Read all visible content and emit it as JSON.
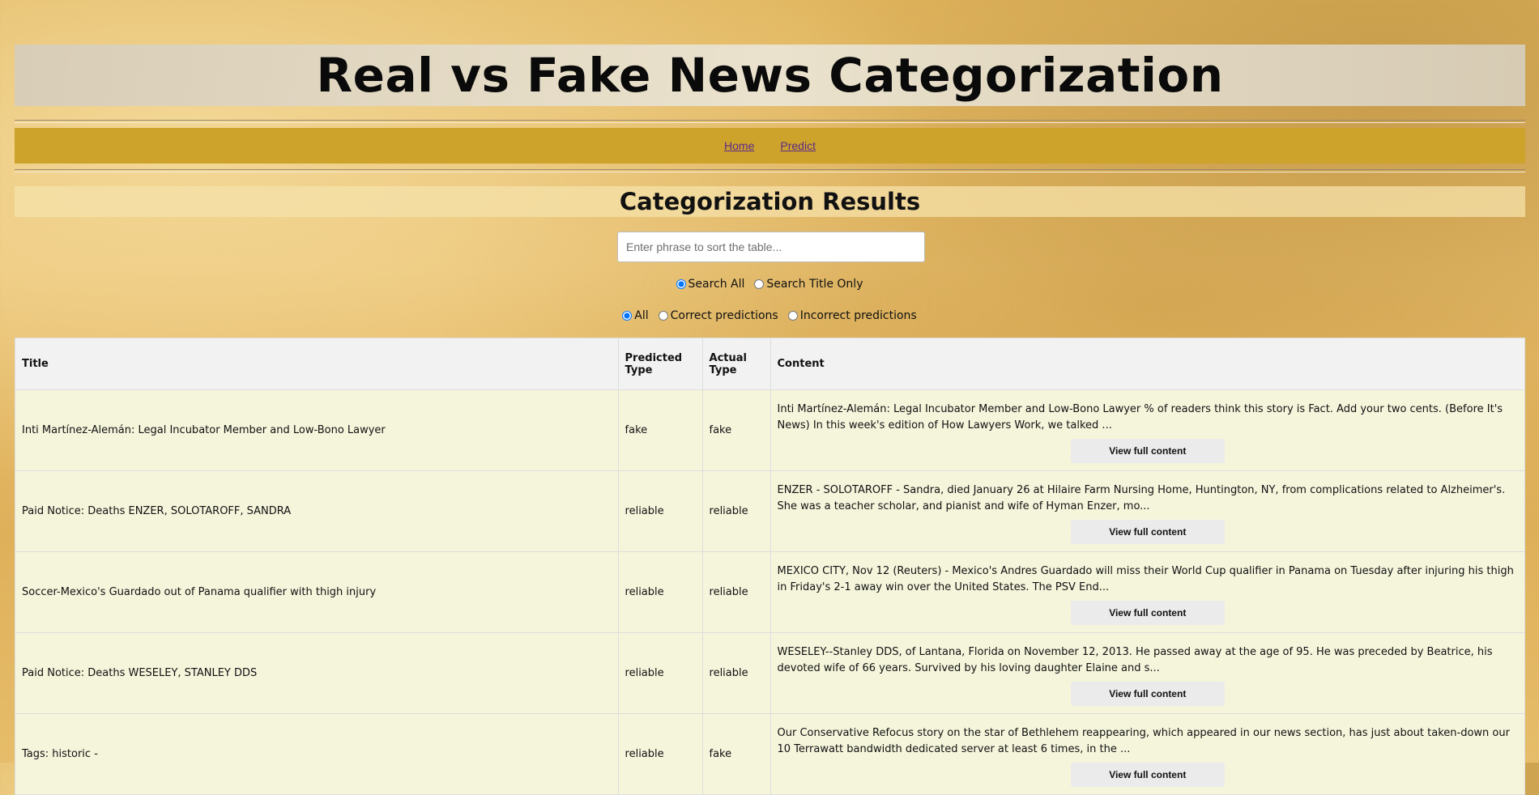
{
  "header": {
    "title": "Real vs Fake News Categorization"
  },
  "nav": {
    "items": [
      "Home",
      "Predict"
    ]
  },
  "section": {
    "title": "Categorization Results"
  },
  "search": {
    "placeholder": "Enter phrase to sort the table..."
  },
  "scope_filter": {
    "options": [
      "Search All",
      "Search Title Only"
    ],
    "selected": "Search All"
  },
  "prediction_filter": {
    "options": [
      "All",
      "Correct predictions",
      "Incorrect predictions"
    ],
    "selected": "All"
  },
  "table": {
    "headers": {
      "title": "Title",
      "predicted": "Predicted Type",
      "actual": "Actual Type",
      "content": "Content"
    },
    "button_label": "View full content",
    "rows": [
      {
        "title": "Inti Martínez-Alemán: Legal Incubator Member and Low-Bono Lawyer",
        "predicted": "fake",
        "actual": "fake",
        "content": "Inti Martínez-Alemán: Legal Incubator Member and Low-Bono Lawyer % of readers think this story is Fact. Add your two cents. (Before It's News) In this week's edition of How Lawyers Work, we talked ..."
      },
      {
        "title": "Paid Notice: Deaths ENZER, SOLOTAROFF, SANDRA",
        "predicted": "reliable",
        "actual": "reliable",
        "content": "ENZER - SOLOTAROFF - Sandra, died January 26 at Hilaire Farm Nursing Home, Huntington, NY, from complications related to Alzheimer's. She was a teacher scholar, and pianist and wife of Hyman Enzer, mo..."
      },
      {
        "title": "Soccer-Mexico's Guardado out of Panama qualifier with thigh injury",
        "predicted": "reliable",
        "actual": "reliable",
        "content": "MEXICO CITY, Nov 12 (Reuters) - Mexico's Andres Guardado will miss their World Cup qualifier in Panama on Tuesday after injuring his thigh in Friday's 2-1 away win over the United States. The PSV End..."
      },
      {
        "title": "Paid Notice: Deaths WESELEY, STANLEY DDS",
        "predicted": "reliable",
        "actual": "reliable",
        "content": "WESELEY--Stanley DDS, of Lantana, Florida on November 12, 2013. He passed away at the age of 95. He was preceded by Beatrice, his devoted wife of 66 years. Survived by his loving daughter Elaine and s..."
      },
      {
        "title": "Tags: historic -",
        "predicted": "reliable",
        "actual": "fake",
        "content": "Our Conservative Refocus story on the star of Bethlehem reappearing, which appeared in our news section, has just about taken-down our 10 Terrawatt bandwidth dedicated server at least 6 times, in the ..."
      }
    ]
  }
}
